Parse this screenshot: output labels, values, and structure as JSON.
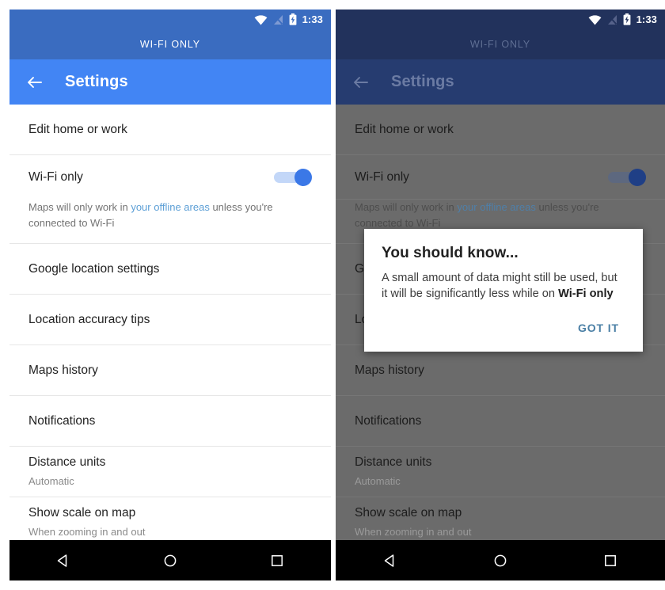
{
  "statusbar": {
    "time": "1:33",
    "icons": [
      "wifi-icon",
      "signal-off-icon",
      "battery-charging-icon"
    ]
  },
  "banner": {
    "label": "WI-FI ONLY"
  },
  "appbar": {
    "title": "Settings",
    "back_icon": "back-arrow-icon"
  },
  "settings": {
    "rows": [
      {
        "title": "Edit home or work"
      },
      {
        "title": "Wi-Fi only"
      },
      {
        "title": "Google location settings"
      },
      {
        "title": "Location accuracy tips"
      },
      {
        "title": "Maps history"
      },
      {
        "title": "Notifications"
      },
      {
        "title": "Distance units",
        "sub": "Automatic"
      },
      {
        "title": "Show scale on map",
        "sub": "When zooming in and out"
      }
    ],
    "wifi_desc": {
      "pre": "Maps will only work in ",
      "link": "your offline areas",
      "post": " unless you're connected to Wi-Fi"
    },
    "wifi_toggle_state": "on"
  },
  "dialog": {
    "title": "You should know...",
    "body_pre": "A small amount of data might still be used, but it will be significantly less while on ",
    "body_bold": "Wi-Fi only",
    "button": "GOT IT"
  },
  "navbar": {
    "back": "nav-back-icon",
    "home": "nav-home-icon",
    "recents": "nav-recents-icon"
  },
  "colors": {
    "status_blue": "#3a6cc0",
    "appbar_blue": "#4285f4",
    "status_blue_dim": "#22325c",
    "appbar_blue_dim": "#263c70",
    "scrim_gray": "#6b6b6b",
    "toggle_on": "#3b78e7",
    "link_blue": "#5c9fd6",
    "dialog_action": "#4a7fa5"
  }
}
